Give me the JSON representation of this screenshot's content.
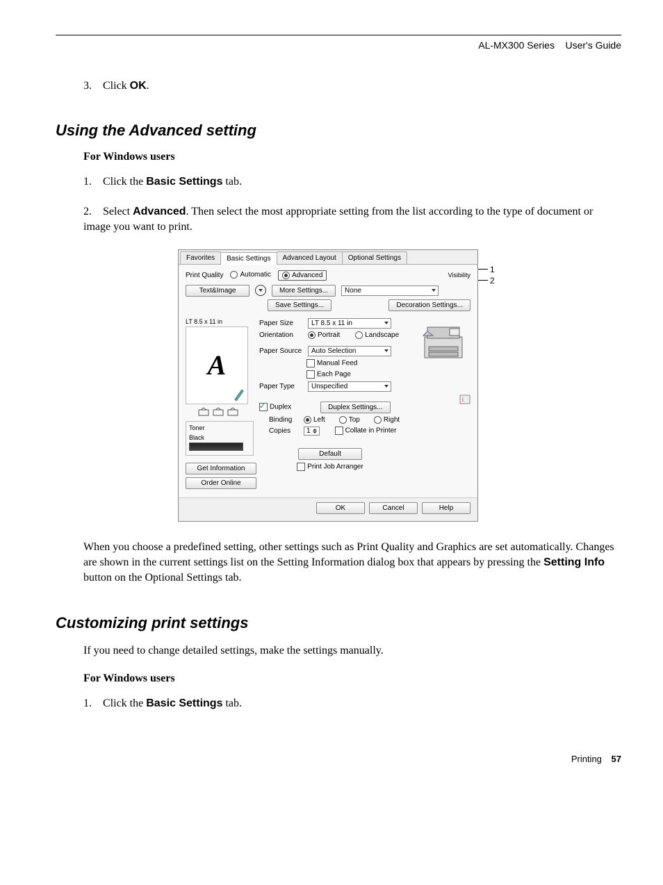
{
  "header": {
    "product": "AL-MX300 Series",
    "doctype": "User's Guide"
  },
  "intro_step": {
    "num": "3.",
    "pre": "Click ",
    "btn": "OK",
    "post": "."
  },
  "section1": {
    "title": "Using the Advanced setting",
    "sub": "For Windows users",
    "step1": {
      "num": "1.",
      "pre": "Click the ",
      "btn": "Basic Settings",
      "post": " tab."
    },
    "step2": {
      "num": "2.",
      "pre": "Select ",
      "btn": "Advanced",
      "post": ". Then select the most appropriate setting from the list according to the type of document or image you want to print."
    }
  },
  "dialog": {
    "tabs": [
      "Favorites",
      "Basic Settings",
      "Advanced Layout",
      "Optional Settings"
    ],
    "active_tab": 1,
    "print_quality_label": "Print Quality",
    "automatic": "Automatic",
    "advanced": "Advanced",
    "visibility": "Visibility",
    "preset": "Text&Image",
    "more_settings": "More Settings...",
    "save_settings": "Save Settings...",
    "none": "None",
    "decoration": "Decoration Settings...",
    "size_name": "LT 8.5 x 11 in",
    "paper_size_lbl": "Paper Size",
    "paper_size_val": "LT 8.5 x 11 in",
    "orientation_lbl": "Orientation",
    "portrait": "Portrait",
    "landscape": "Landscape",
    "paper_source_lbl": "Paper Source",
    "paper_source_val": "Auto Selection",
    "manual_feed": "Manual Feed",
    "each_page": "Each Page",
    "paper_type_lbl": "Paper Type",
    "paper_type_val": "Unspecified",
    "toner_lbl": "Toner",
    "black": "Black",
    "duplex": "Duplex",
    "duplex_settings": "Duplex Settings...",
    "binding_lbl": "Binding",
    "left": "Left",
    "top": "Top",
    "right": "Right",
    "copies_lbl": "Copies",
    "copies_val": "1",
    "collate": "Collate in Printer",
    "get_info": "Get Information",
    "order_online": "Order Online",
    "default": "Default",
    "pja": "Print Job Arranger",
    "ok": "OK",
    "cancel": "Cancel",
    "help": "Help",
    "anno1": "1",
    "anno2": "2"
  },
  "explain": {
    "pre": "When you choose a predefined setting, other settings such as Print Quality and Graphics are set automatically. Changes are shown in the current settings list on the Setting Information dialog box that appears by pressing the ",
    "btn": "Setting Info",
    "post": " button on the Optional Settings tab."
  },
  "section2": {
    "title": "Customizing print settings",
    "para": "If you need to change detailed settings, make the settings manually.",
    "sub": "For Windows users",
    "step1": {
      "num": "1.",
      "pre": "Click the ",
      "btn": "Basic Settings",
      "post": " tab."
    }
  },
  "footer": {
    "chapter": "Printing",
    "page": "57"
  }
}
